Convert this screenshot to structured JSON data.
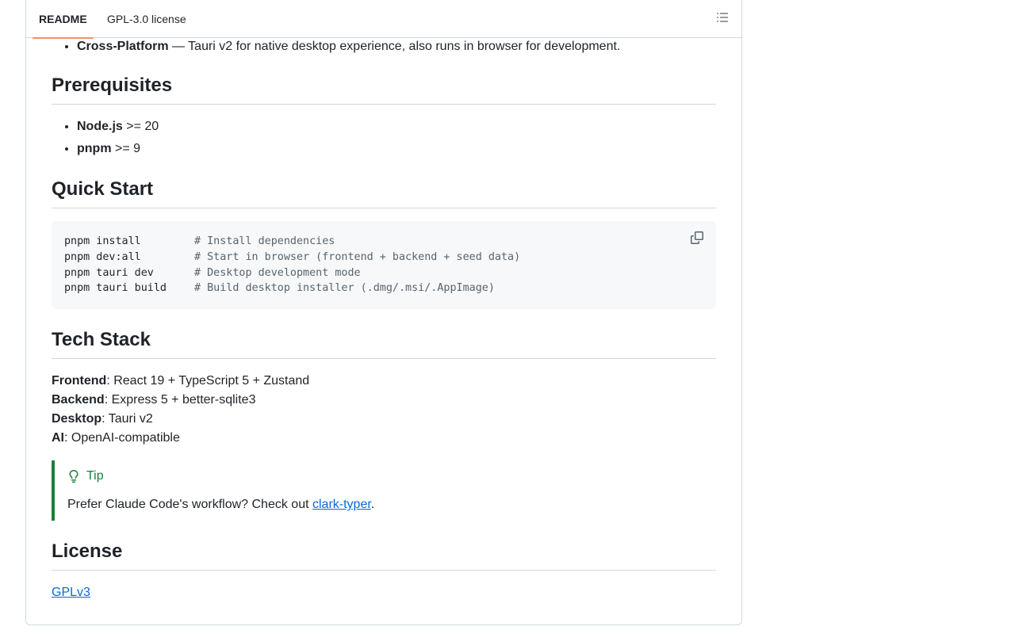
{
  "tabs": {
    "readme": "README",
    "license": "GPL-3.0 license"
  },
  "features": {
    "cross_platform_label": "Cross-Platform",
    "cross_platform_text": " — Tauri v2 for native desktop experience, also runs in browser for development."
  },
  "prerequisites": {
    "heading": "Prerequisites",
    "items": [
      {
        "name": "Node.js",
        "version": " >= 20"
      },
      {
        "name": "pnpm",
        "version": " >= 9"
      }
    ]
  },
  "quick_start": {
    "heading": "Quick Start",
    "commands": [
      {
        "cmd": "pnpm install",
        "comment": "# Install dependencies"
      },
      {
        "cmd": "pnpm dev:all",
        "comment": "# Start in browser (frontend + backend + seed data)"
      },
      {
        "cmd": "pnpm tauri dev",
        "comment": "# Desktop development mode"
      },
      {
        "cmd": "pnpm tauri build",
        "comment": "# Build desktop installer (.dmg/.msi/.AppImage)"
      }
    ]
  },
  "tech_stack": {
    "heading": "Tech Stack",
    "items": [
      {
        "label": "Frontend",
        "value": ": React 19 + TypeScript 5 + Zustand"
      },
      {
        "label": "Backend",
        "value": ": Express 5 + better-sqlite3"
      },
      {
        "label": "Desktop",
        "value": ": Tauri v2"
      },
      {
        "label": "AI",
        "value": ": OpenAI-compatible"
      }
    ]
  },
  "tip": {
    "title": "Tip",
    "text_before": "Prefer Claude Code's workflow? Check out ",
    "link": "clark-typer",
    "text_after": "."
  },
  "license": {
    "heading": "License",
    "link": "GPLv3"
  },
  "colors": {
    "tab_underline": "#fd8c73",
    "tip_green": "#1a7f37",
    "link_blue": "#0969da"
  },
  "icons": {
    "toc": "list-unordered-icon",
    "copy": "copy-icon",
    "tip": "light-bulb-icon"
  }
}
